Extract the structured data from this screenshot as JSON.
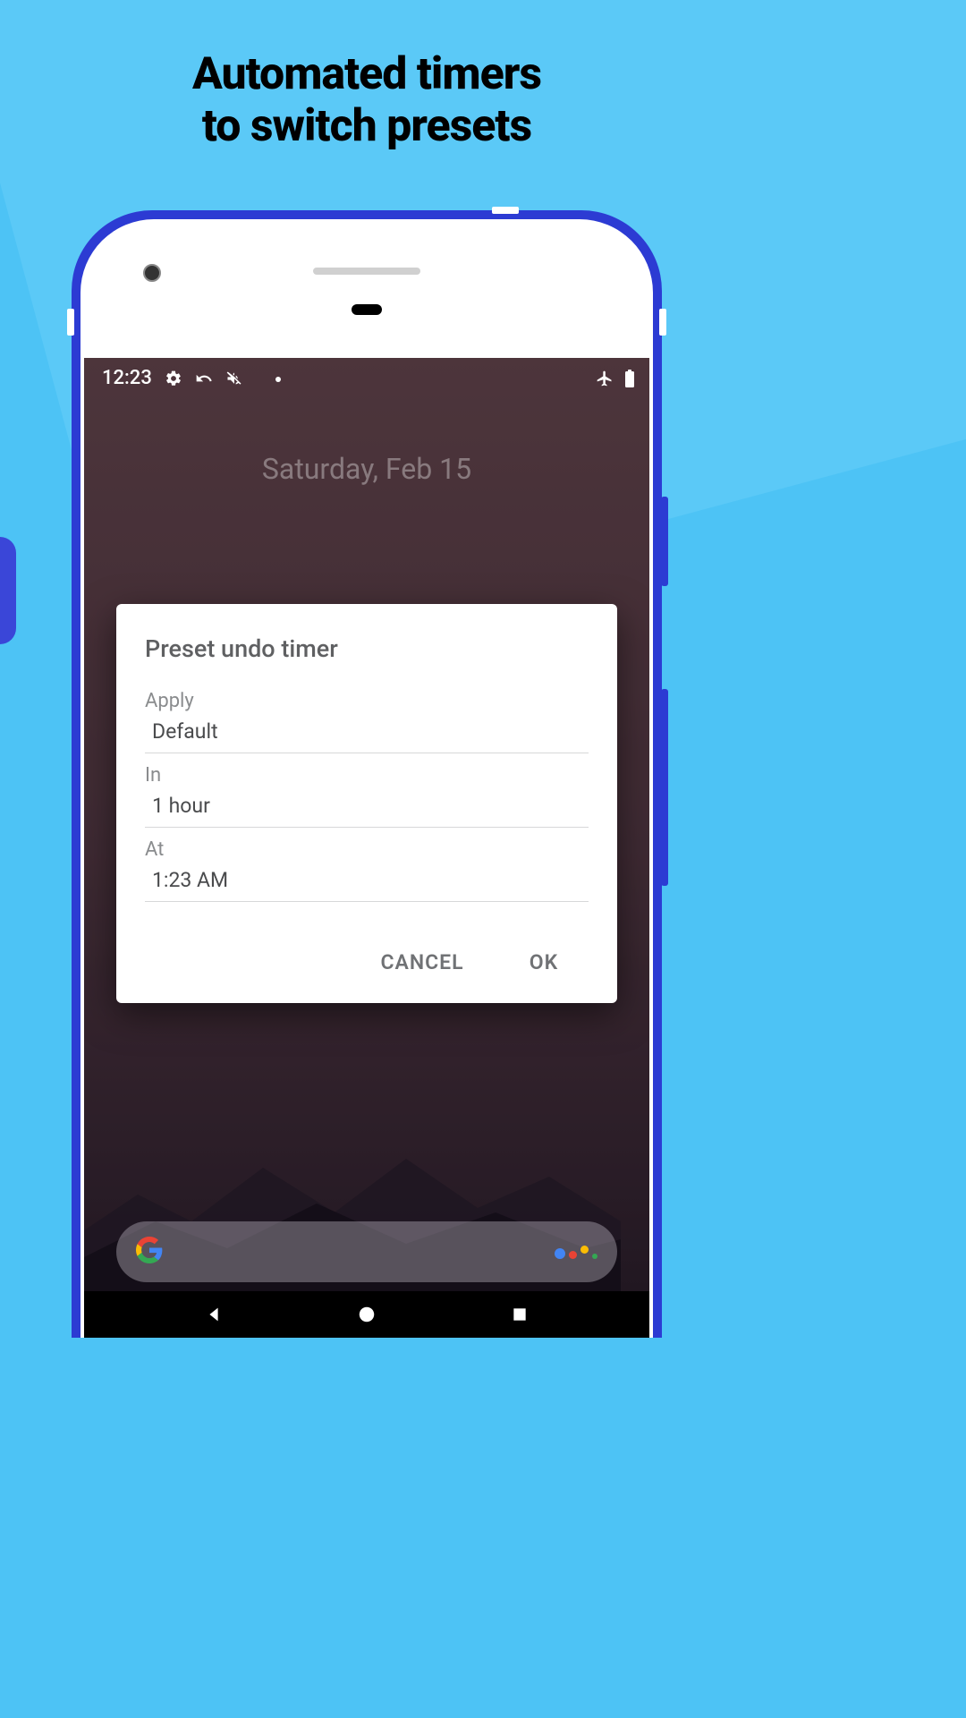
{
  "tagline_line1": "Automated timers",
  "tagline_line2": "to switch presets",
  "status_bar": {
    "time": "12:23"
  },
  "home": {
    "date": "Saturday, Feb 15"
  },
  "dialog": {
    "title": "Preset undo timer",
    "field_apply_label": "Apply",
    "field_apply_value": "Default",
    "field_in_label": "In",
    "field_in_value": "1 hour",
    "field_at_label": "At",
    "field_at_value": "1:23 AM",
    "cancel_label": "CANCEL",
    "ok_label": "OK"
  }
}
